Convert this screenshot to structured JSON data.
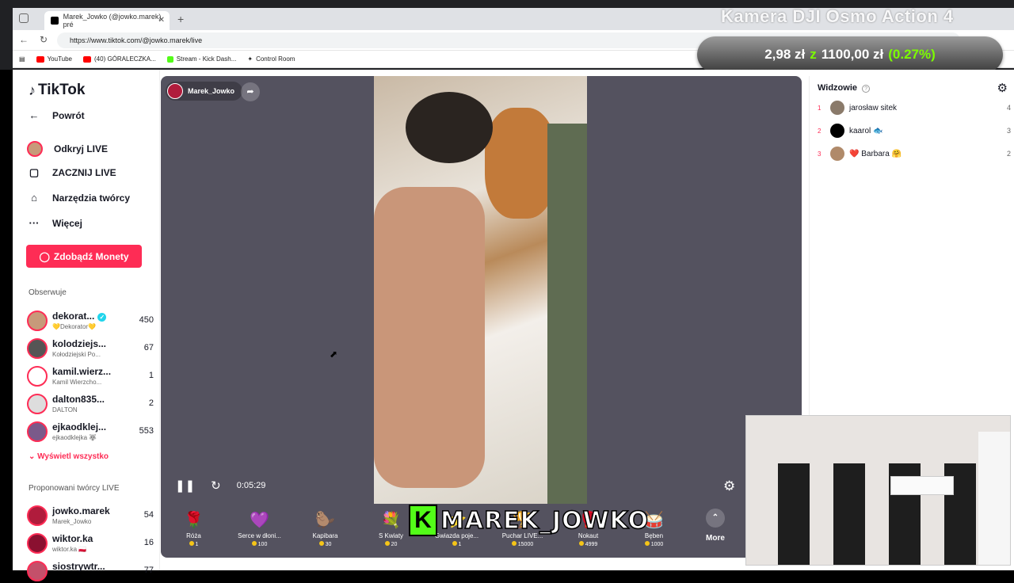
{
  "browser": {
    "tab_title": "Marek_Jowko (@jowko.marek) pré",
    "new_tab": "+",
    "close_tab": "✕",
    "url": "https://www.tiktok.com/@jowko.marek/live",
    "bookmarks": [
      {
        "label": "YouTube",
        "color": "#ff0000"
      },
      {
        "label": "(40) GÓRALECZKA...",
        "color": "#ff0000"
      },
      {
        "label": "Stream - Kick Dash...",
        "color": "#53fc18"
      },
      {
        "label": "Control Room",
        "color": "#333333"
      }
    ]
  },
  "overlay": {
    "title": "Kamera DJI Osmo Action 4",
    "price": "2,98 zł",
    "z": "z",
    "target": "1100,00 zł",
    "pct": "(0.27%)"
  },
  "sidebar": {
    "logo": "TikTok",
    "back": "Powrót",
    "items": [
      {
        "label": "Odkryj LIVE",
        "icon": "live-avatar-icon"
      },
      {
        "label": "ZACZNIJ LIVE",
        "icon": "camera-icon"
      },
      {
        "label": "Narzędzia twórcy",
        "icon": "creator-tools-icon"
      },
      {
        "label": "Więcej",
        "icon": "more-dots-icon"
      }
    ],
    "coins_button": "Zdobądź Monety",
    "following_header": "Obserwuje",
    "following": [
      {
        "name": "dekorat...",
        "sub": "💛Dekorator💛",
        "count": "450",
        "verified": true
      },
      {
        "name": "kolodziejs...",
        "sub": "Kołodziejski Po...",
        "count": "67"
      },
      {
        "name": "kamil.wierz...",
        "sub": "Kamil Wierzcho...",
        "count": "1"
      },
      {
        "name": "dalton835...",
        "sub": "DALTON",
        "count": "2"
      },
      {
        "name": "ejkaodklej...",
        "sub": "ejkaodklejka 🐺",
        "count": "553"
      }
    ],
    "show_all": "Wyświetl wszystko",
    "suggested_header": "Proponowani twórcy LIVE",
    "suggested": [
      {
        "name": "jowko.marek",
        "sub": "Marek_Jowko",
        "count": "54"
      },
      {
        "name": "wiktor.ka",
        "sub": "wiktor.ka 🇵🇱",
        "count": "16"
      },
      {
        "name": "siostrywtr...",
        "sub": "",
        "count": "77"
      }
    ]
  },
  "player": {
    "host_name": "Marek_Jowko",
    "time": "0:05:29",
    "gifts": [
      {
        "name": "Róża",
        "price": "1",
        "glyph": "🌹"
      },
      {
        "name": "Serce w dłoni...",
        "price": "100",
        "glyph": "💜"
      },
      {
        "name": "Kapibara",
        "price": "30",
        "glyph": "🦫"
      },
      {
        "name": "S Kwiaty",
        "price": "20",
        "glyph": "💐"
      },
      {
        "name": "Gwiazda poje...",
        "price": "1",
        "glyph": "⭐"
      },
      {
        "name": "Puchar LIVE...",
        "price": "15000",
        "glyph": "🏆"
      },
      {
        "name": "Nokaut",
        "price": "4999",
        "glyph": "🥊"
      },
      {
        "name": "Bęben",
        "price": "1000",
        "glyph": "🥁"
      }
    ],
    "more": "More",
    "streamer_tag": "MAREK_JOWKO",
    "kick_letter": "K"
  },
  "viewers": {
    "header": "Widzowie",
    "list": [
      {
        "rank": "1",
        "name": "jarosław sitek",
        "score": "4"
      },
      {
        "rank": "2",
        "name": "kaarol 🐟",
        "score": "3"
      },
      {
        "rank": "3",
        "name": "❤️ Barbara 🤗",
        "score": "2"
      }
    ]
  }
}
